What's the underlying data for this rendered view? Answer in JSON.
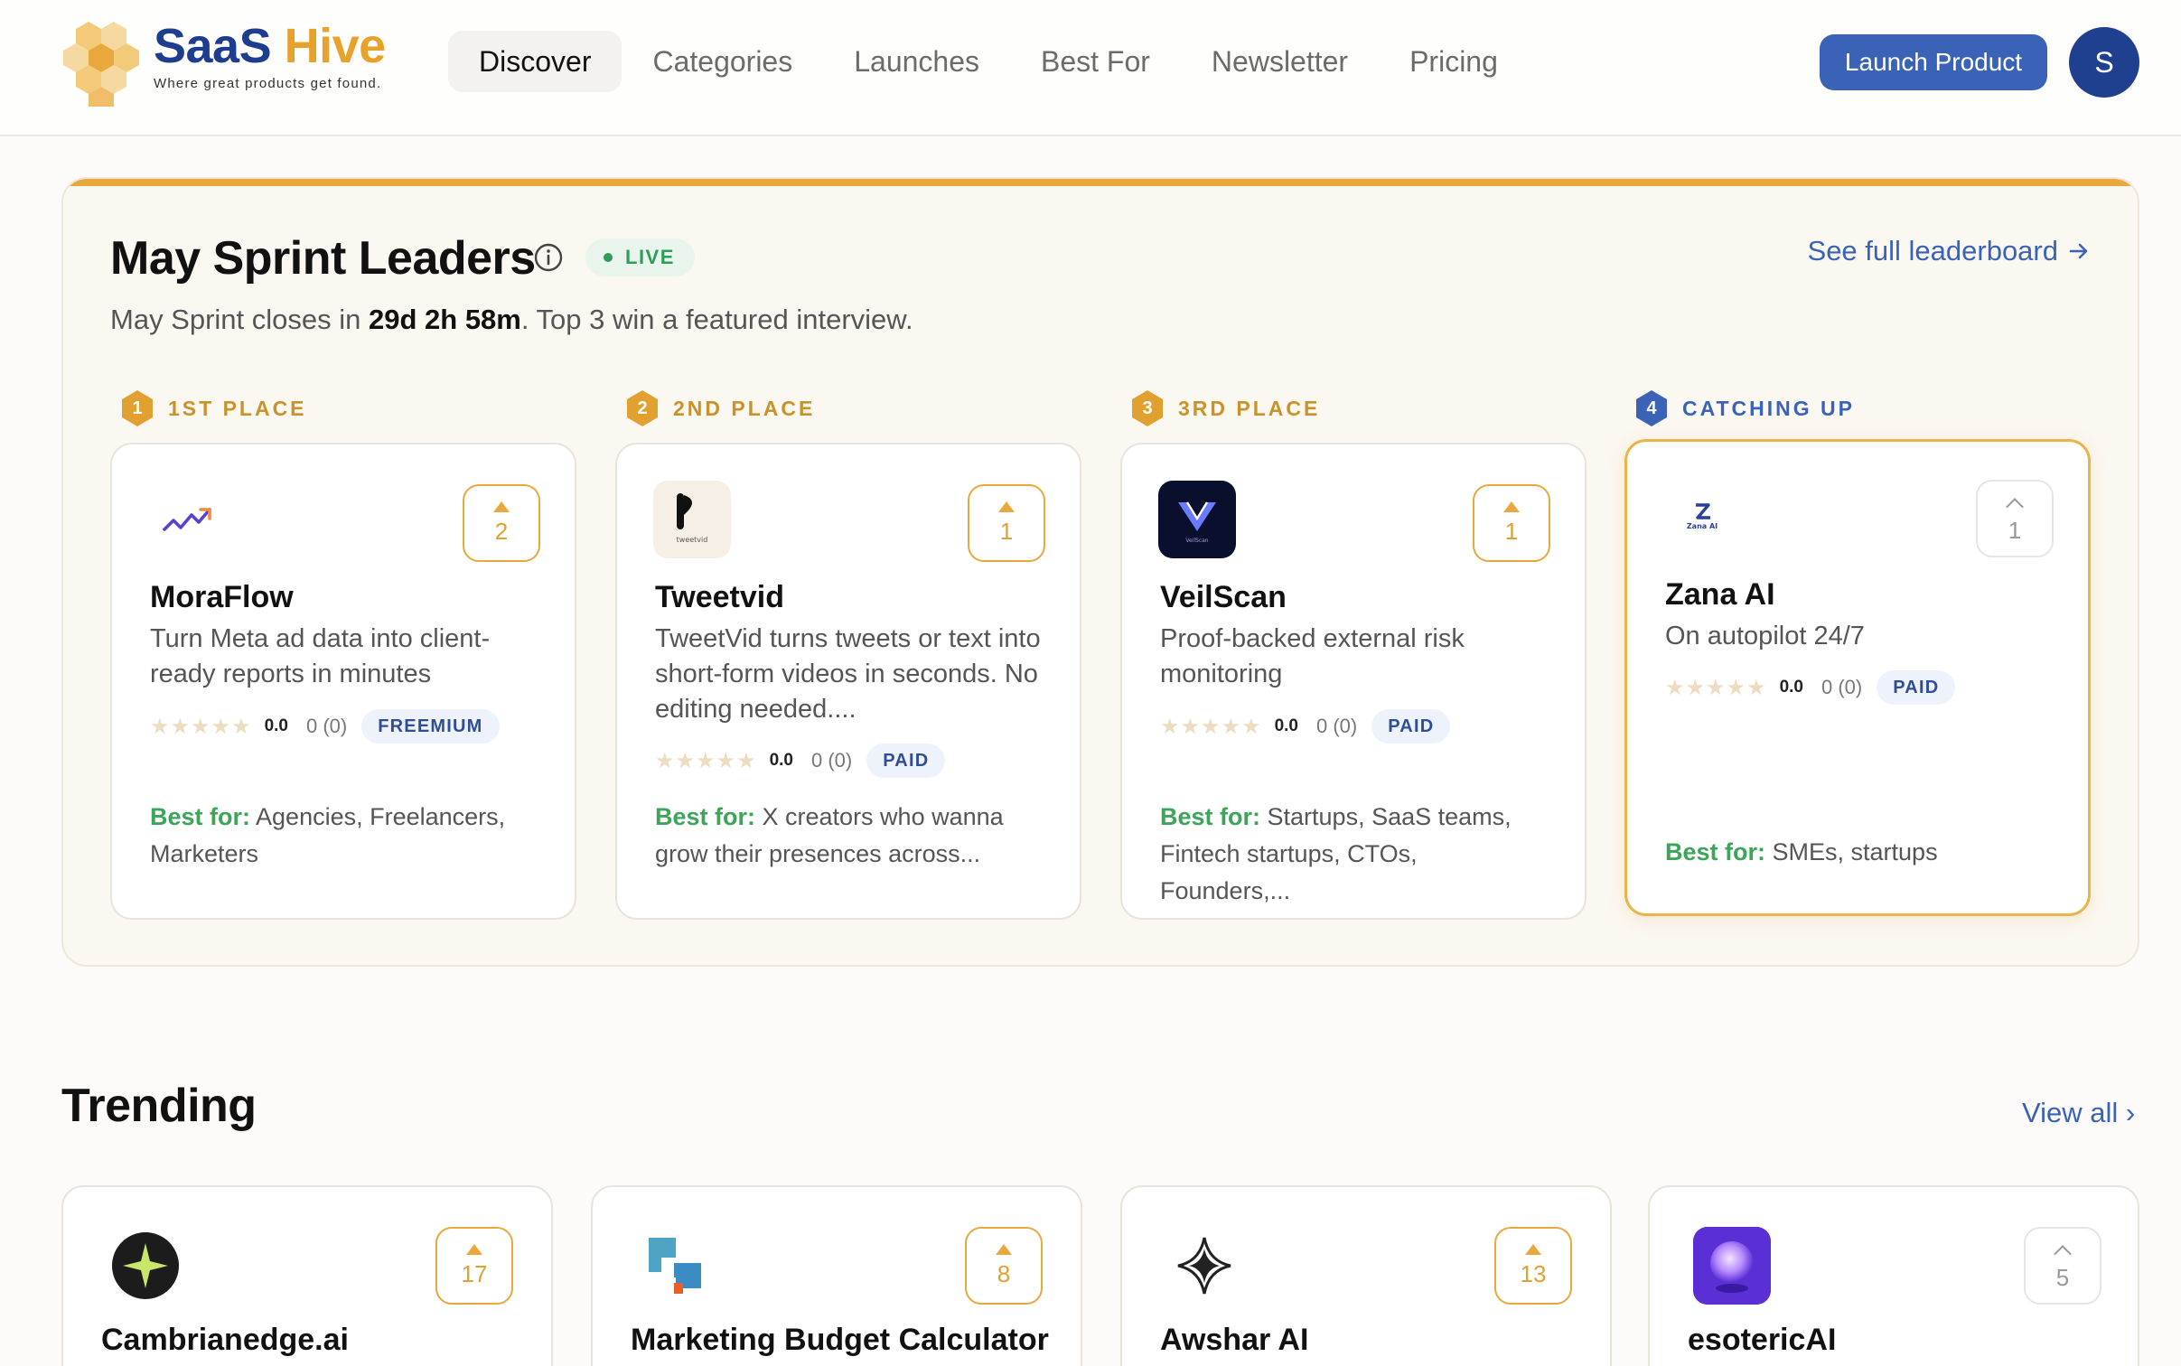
{
  "brand": {
    "name_part1": "SaaS",
    "name_part2": "Hive",
    "tagline": "Where great products get found."
  },
  "nav": {
    "items": [
      {
        "label": "Discover",
        "active": true
      },
      {
        "label": "Categories"
      },
      {
        "label": "Launches"
      },
      {
        "label": "Best For"
      },
      {
        "label": "Newsletter"
      },
      {
        "label": "Pricing"
      }
    ],
    "launch_label": "Launch Product",
    "avatar_initial": "S"
  },
  "sprint": {
    "title": "May Sprint Leaders",
    "live_label": "LIVE",
    "subtitle_pre": "May Sprint closes in ",
    "countdown": "29d 2h 58m",
    "subtitle_post": ". Top 3 win a featured interview.",
    "see_full_label": "See full leaderboard",
    "places": [
      {
        "rank": "1",
        "label": "1ST PLACE"
      },
      {
        "rank": "2",
        "label": "2ND PLACE"
      },
      {
        "rank": "3",
        "label": "3RD PLACE"
      },
      {
        "rank": "4",
        "label": "CATCHING UP"
      }
    ],
    "cards": [
      {
        "name": "MoraFlow",
        "votes": "2",
        "desc": "Turn Meta ad data into client-ready reports in minutes",
        "stars": "★★★★★",
        "score": "0.0",
        "count": "0 (0)",
        "pricing": "FREEMIUM",
        "bestfor_label": "Best for:",
        "bestfor": " Agencies, Freelancers, Marketers"
      },
      {
        "name": "Tweetvid",
        "logo_text": "tweetvid",
        "votes": "1",
        "desc": "TweetVid turns tweets or text into short-form videos in seconds. No editing needed....",
        "stars": "★★★★★",
        "score": "0.0",
        "count": "0 (0)",
        "pricing": "PAID",
        "bestfor_label": "Best for:",
        "bestfor": " X creators who wanna grow their presences across..."
      },
      {
        "name": "VeilScan",
        "logo_text": "VeilScan",
        "votes": "1",
        "desc": "Proof-backed external risk monitoring",
        "stars": "★★★★★",
        "score": "0.0",
        "count": "0 (0)",
        "pricing": "PAID",
        "bestfor_label": "Best for:",
        "bestfor": " Startups, SaaS teams, Fintech startups, CTOs, Founders,..."
      },
      {
        "name": "Zana AI",
        "logo_text": "Zana AI",
        "votes": "1",
        "desc": "On autopilot 24/7",
        "stars": "★★★★★",
        "score": "0.0",
        "count": "0 (0)",
        "pricing": "PAID",
        "bestfor_label": "Best for:",
        "bestfor": " SMEs, startups"
      }
    ]
  },
  "trending": {
    "title": "Trending",
    "viewall_label": "View all",
    "cards": [
      {
        "name": "Cambrianedge.ai",
        "votes": "17"
      },
      {
        "name": "Marketing Budget Calculator",
        "votes": "8"
      },
      {
        "name": "Awshar AI",
        "votes": "13"
      },
      {
        "name": "esotericAI",
        "votes": "5"
      }
    ]
  },
  "colors": {
    "accent": "#3a63b8",
    "brand_dark": "#1e3d8f",
    "gold": "#e9a83c",
    "green": "#3da55a"
  }
}
